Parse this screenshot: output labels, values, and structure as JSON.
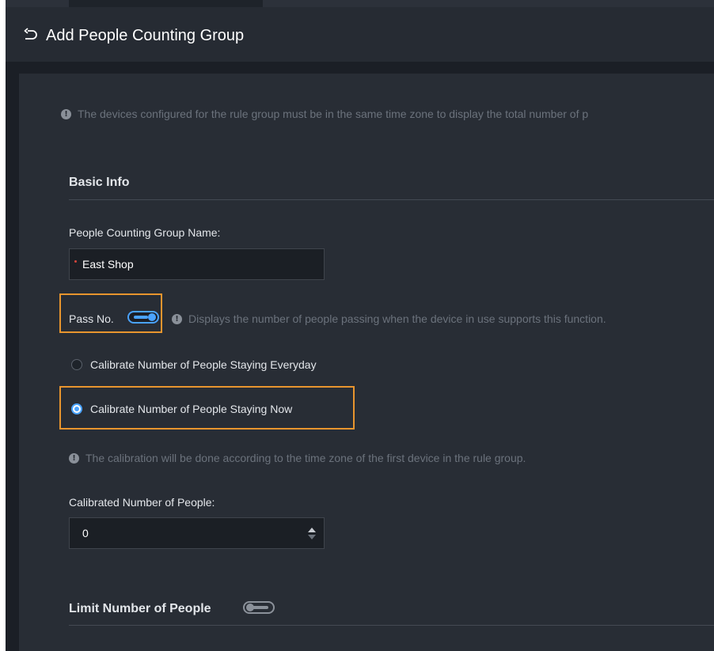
{
  "header": {
    "back_icon": "undo-arrow-icon",
    "title": "Add People Counting Group"
  },
  "notices": {
    "time_zone": "The devices configured for the rule group must be in the same time zone to display the total number of p",
    "pass_no": "Displays the number of people passing when the device in use supports this function.",
    "calibration": "The calibration will be done according to the time zone of the first device in the rule group.",
    "icon": "info-circle-icon"
  },
  "basic_info": {
    "title": "Basic Info",
    "group_name_label": "People Counting Group Name:",
    "group_name_value": "East Shop",
    "pass_no_label": "Pass No.",
    "pass_no_enabled": true
  },
  "calibration": {
    "options": [
      {
        "label": "Calibrate Number of People Staying Everyday",
        "selected": false
      },
      {
        "label": "Calibrate Number of People Staying Now",
        "selected": true
      }
    ],
    "number_label": "Calibrated Number of People:",
    "number_value": "0"
  },
  "limit": {
    "title": "Limit Number of People",
    "enabled": false
  },
  "colors": {
    "accent": "#4aa3ff",
    "highlight": "#e8952e",
    "required": "#d5453b",
    "background": "#1b1f26",
    "panel": "#282d35"
  }
}
